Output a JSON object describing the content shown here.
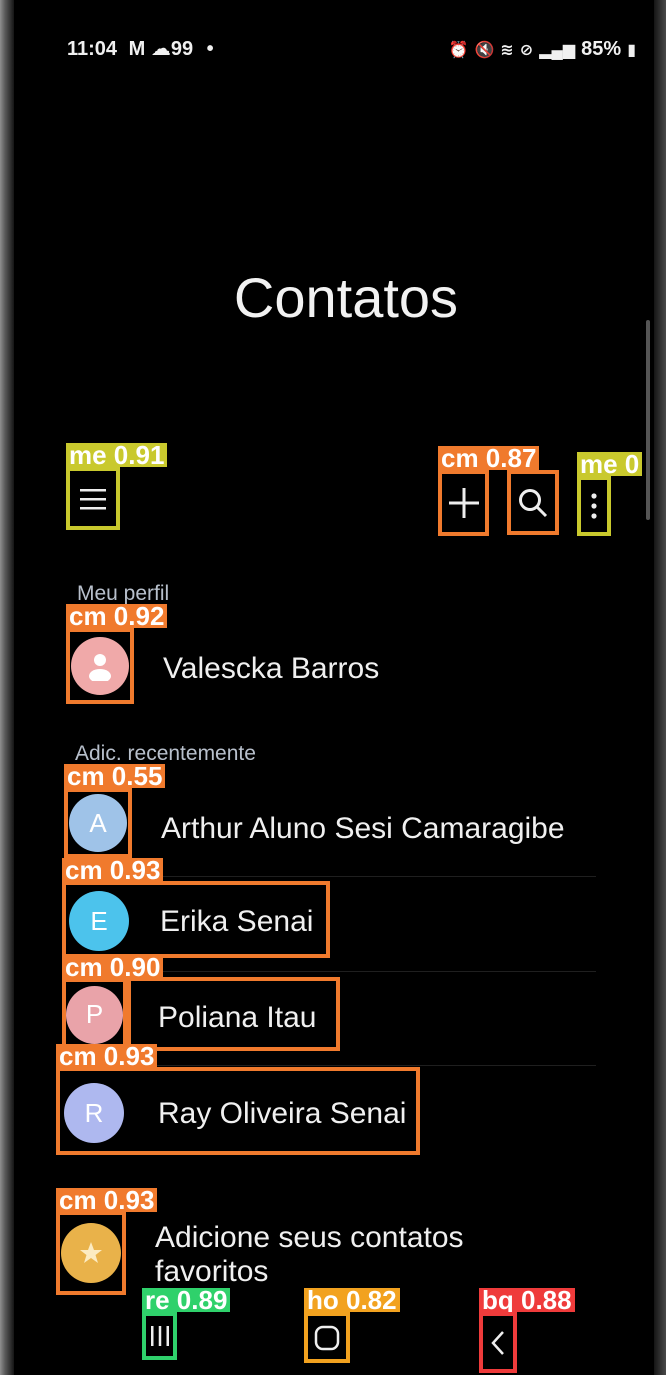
{
  "status_bar": {
    "time": "11:04",
    "notif_icons": "M ☁99",
    "battery": "85%"
  },
  "page": {
    "title": "Contatos"
  },
  "toolbar": {
    "menu_icon": "hamburger-menu-icon",
    "add_icon": "plus-icon",
    "search_icon": "search-icon",
    "more_icon": "more-vert-icon"
  },
  "detections": {
    "menu": "me 0.91",
    "add": "cm 0.87",
    "more": "me 0",
    "profile_avatar": "cm 0.92",
    "arthur": "cm 0.55",
    "erika": "cm 0.93",
    "poliana": "cm 0.90",
    "ray": "cm 0.93",
    "favorites": "cm 0.93",
    "recents": "re 0.89",
    "home": "ho 0.82",
    "back": "bq 0.88"
  },
  "profile": {
    "section_label": "Meu perfil",
    "name": "Valescka Barros"
  },
  "recent": {
    "section_label": "Adic. recentemente",
    "contacts": [
      {
        "initial": "A",
        "name": "Arthur Aluno Sesi Camaragibe",
        "color": "#9fc3e8"
      },
      {
        "initial": "E",
        "name": "Erika Senai",
        "color": "#4cc3ec"
      },
      {
        "initial": "P",
        "name": "Poliana Itau",
        "color": "#e9a3a9"
      },
      {
        "initial": "R",
        "name": "Ray Oliveira Senai",
        "color": "#aeb8ef"
      }
    ]
  },
  "favorites": {
    "line1": "Adicione seus contatos",
    "line2": "favoritos",
    "color": "#e9b24a"
  },
  "colors": {
    "accent_orange": "#f07a2d",
    "accent_yellow": "#c9c92d",
    "accent_green": "#2fd16b",
    "accent_red": "#ef3b3b"
  }
}
